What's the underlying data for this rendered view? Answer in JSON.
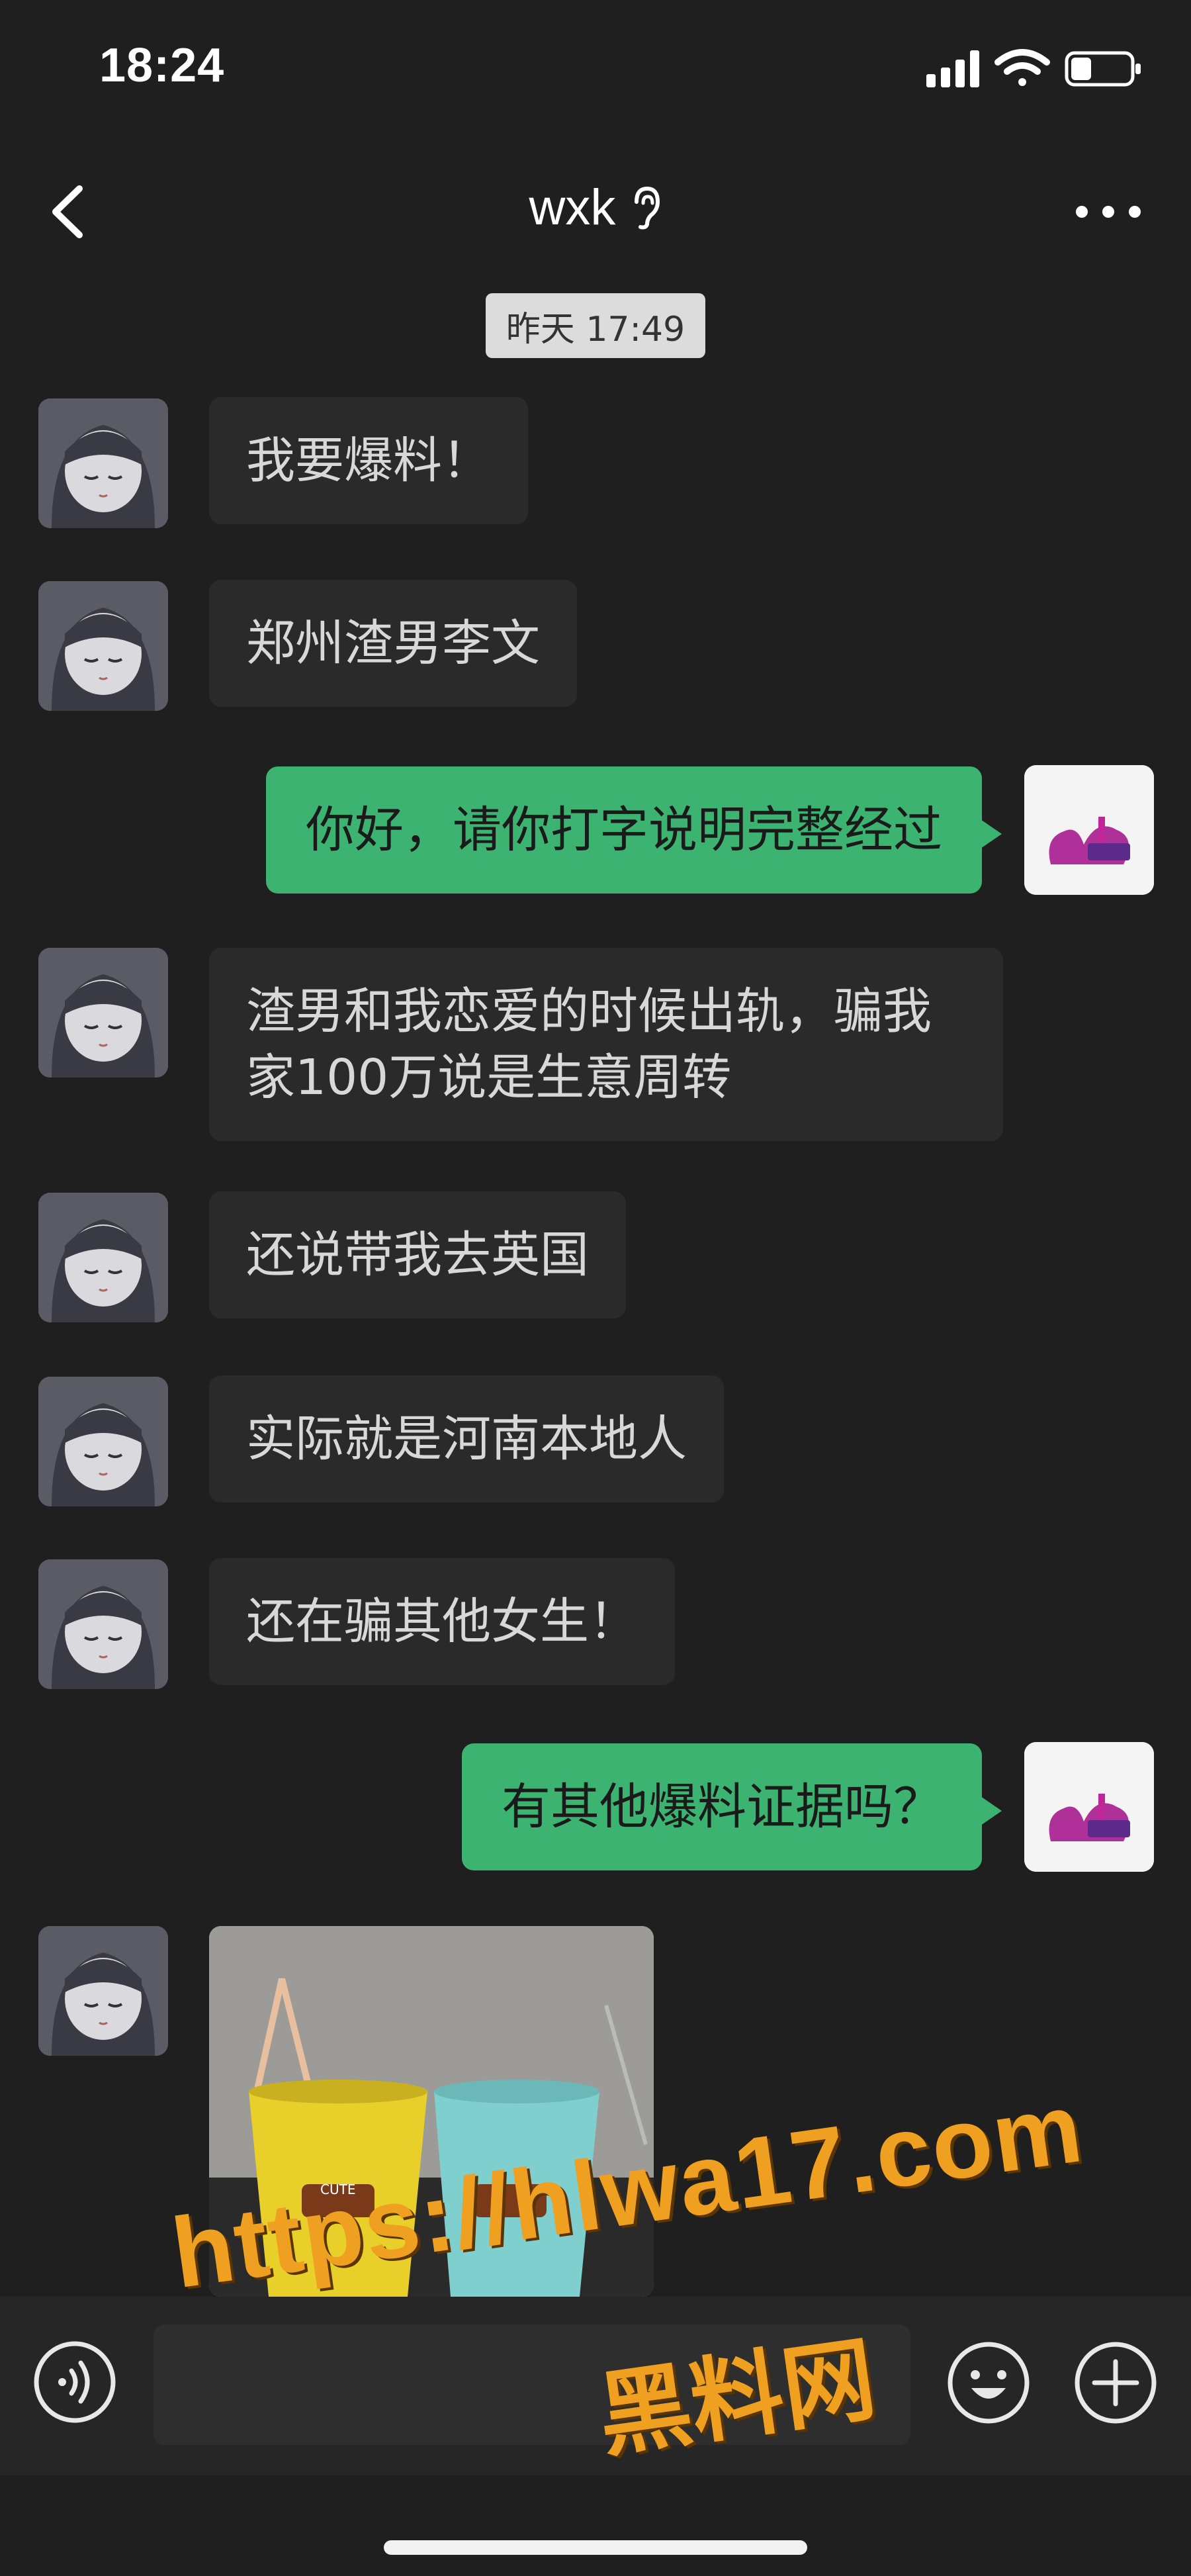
{
  "status_bar": {
    "time": "18:24",
    "icons": [
      "signal-icon",
      "wifi-icon",
      "battery-icon"
    ],
    "battery_level": 0.35
  },
  "header": {
    "title": "wxk",
    "title_icon": "ear-icon",
    "back_icon": "back-chevron-icon",
    "more_icon": "more-dots-icon"
  },
  "timestamp": "昨天 17:49",
  "messages": [
    {
      "side": "in",
      "text": "我要爆料！"
    },
    {
      "side": "in",
      "text": "郑州渣男李文"
    },
    {
      "side": "out",
      "text": "你好，请你打字说明完整经过"
    },
    {
      "side": "in",
      "text": "渣男和我恋爱的时候出轨，骗我家100万说是生意周转"
    },
    {
      "side": "in",
      "text": "还说带我去英国"
    },
    {
      "side": "in",
      "text": "实际就是河南本地人"
    },
    {
      "side": "in",
      "text": "还在骗其他女生！"
    },
    {
      "side": "out",
      "text": "有其他爆料证据吗？"
    },
    {
      "side": "in",
      "type": "image",
      "text": ""
    }
  ],
  "image_message": {
    "cup_text": "CUTE"
  },
  "input_bar": {
    "voice_icon": "voice-icon",
    "emoji_icon": "emoji-icon",
    "plus_icon": "plus-icon",
    "value": ""
  },
  "watermark": {
    "url": "https://hlwa17.com",
    "name": "黑料网"
  },
  "colors": {
    "background": "#1f1f1f",
    "incoming_bubble": "#2a2a2a",
    "outgoing_bubble": "#3cb371",
    "watermark": "#f0a020"
  }
}
